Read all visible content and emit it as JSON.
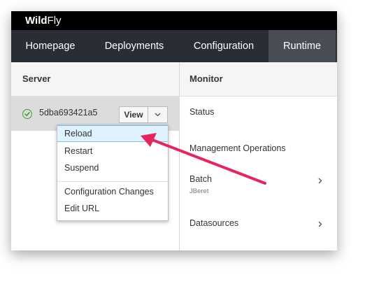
{
  "brand": {
    "part1": "Wild",
    "part2": "Fly"
  },
  "nav": [
    {
      "label": "Homepage"
    },
    {
      "label": "Deployments"
    },
    {
      "label": "Configuration"
    },
    {
      "label": "Runtime",
      "active": true
    }
  ],
  "server_column": {
    "header": "Server",
    "row": {
      "name": "5dba693421a5",
      "view_label": "View",
      "status": "running"
    }
  },
  "dropdown": {
    "items": [
      {
        "label": "Reload",
        "highlighted": true
      },
      {
        "label": "Restart"
      },
      {
        "label": "Suspend"
      },
      {
        "label": "Configuration Changes"
      },
      {
        "label": "Edit URL"
      }
    ]
  },
  "monitor_column": {
    "header": "Monitor",
    "items": [
      {
        "label": "Status"
      },
      {
        "label": "Management Operations"
      },
      {
        "label": "Batch",
        "sublabel": "JBeret",
        "has_children": true
      },
      {
        "label": "Datasources",
        "has_children": true
      }
    ]
  },
  "colors": {
    "topbar": "#000000",
    "navbar": "#292e34",
    "nav_active": "#494e54",
    "status_ok": "#3f9c35",
    "highlight": "#def3ff",
    "annotation_arrow": "#e8245e"
  }
}
